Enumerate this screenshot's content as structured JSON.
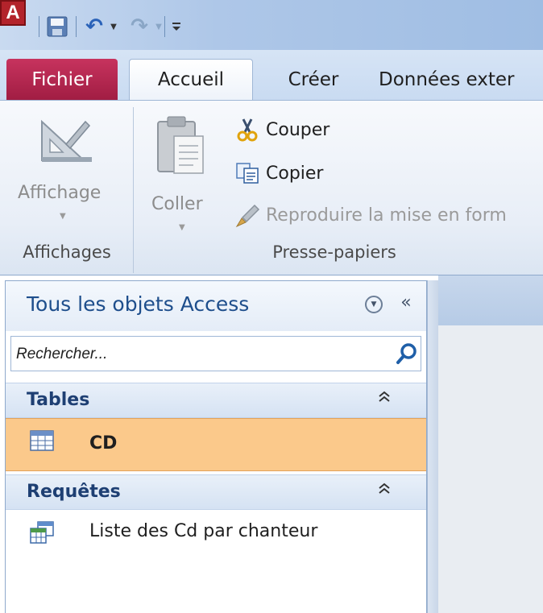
{
  "app": {
    "icon_letter": "A",
    "accent": "#b3232b"
  },
  "quick_access": {
    "icons": [
      "access-app-icon",
      "save-icon",
      "undo-icon",
      "redo-icon",
      "customize-qat-icon"
    ]
  },
  "tabs": {
    "file": "Fichier",
    "home": "Accueil",
    "create": "Créer",
    "external": "Données exter"
  },
  "ribbon": {
    "views": {
      "view_button": "Affichage",
      "group_label": "Affichages"
    },
    "clipboard": {
      "paste_button": "Coller",
      "cut": "Couper",
      "copy": "Copier",
      "format_painter": "Reproduire la mise en form",
      "group_label": "Presse-papiers"
    }
  },
  "nav_pane": {
    "title": "Tous les objets Access",
    "collapse_glyph": "«",
    "toggle_glyph": "⌃",
    "search": {
      "placeholder": "Rechercher..."
    },
    "sections": [
      {
        "title": "Tables",
        "items": [
          {
            "label": "CD",
            "selected": true
          }
        ]
      },
      {
        "title": "Requêtes",
        "items": [
          {
            "label": "Liste des Cd par chanteur",
            "selected": false
          }
        ]
      }
    ]
  },
  "colors": {
    "selection": "#fbc98b",
    "file_tab": "#b82652",
    "nav_title": "#1e4e8c"
  }
}
